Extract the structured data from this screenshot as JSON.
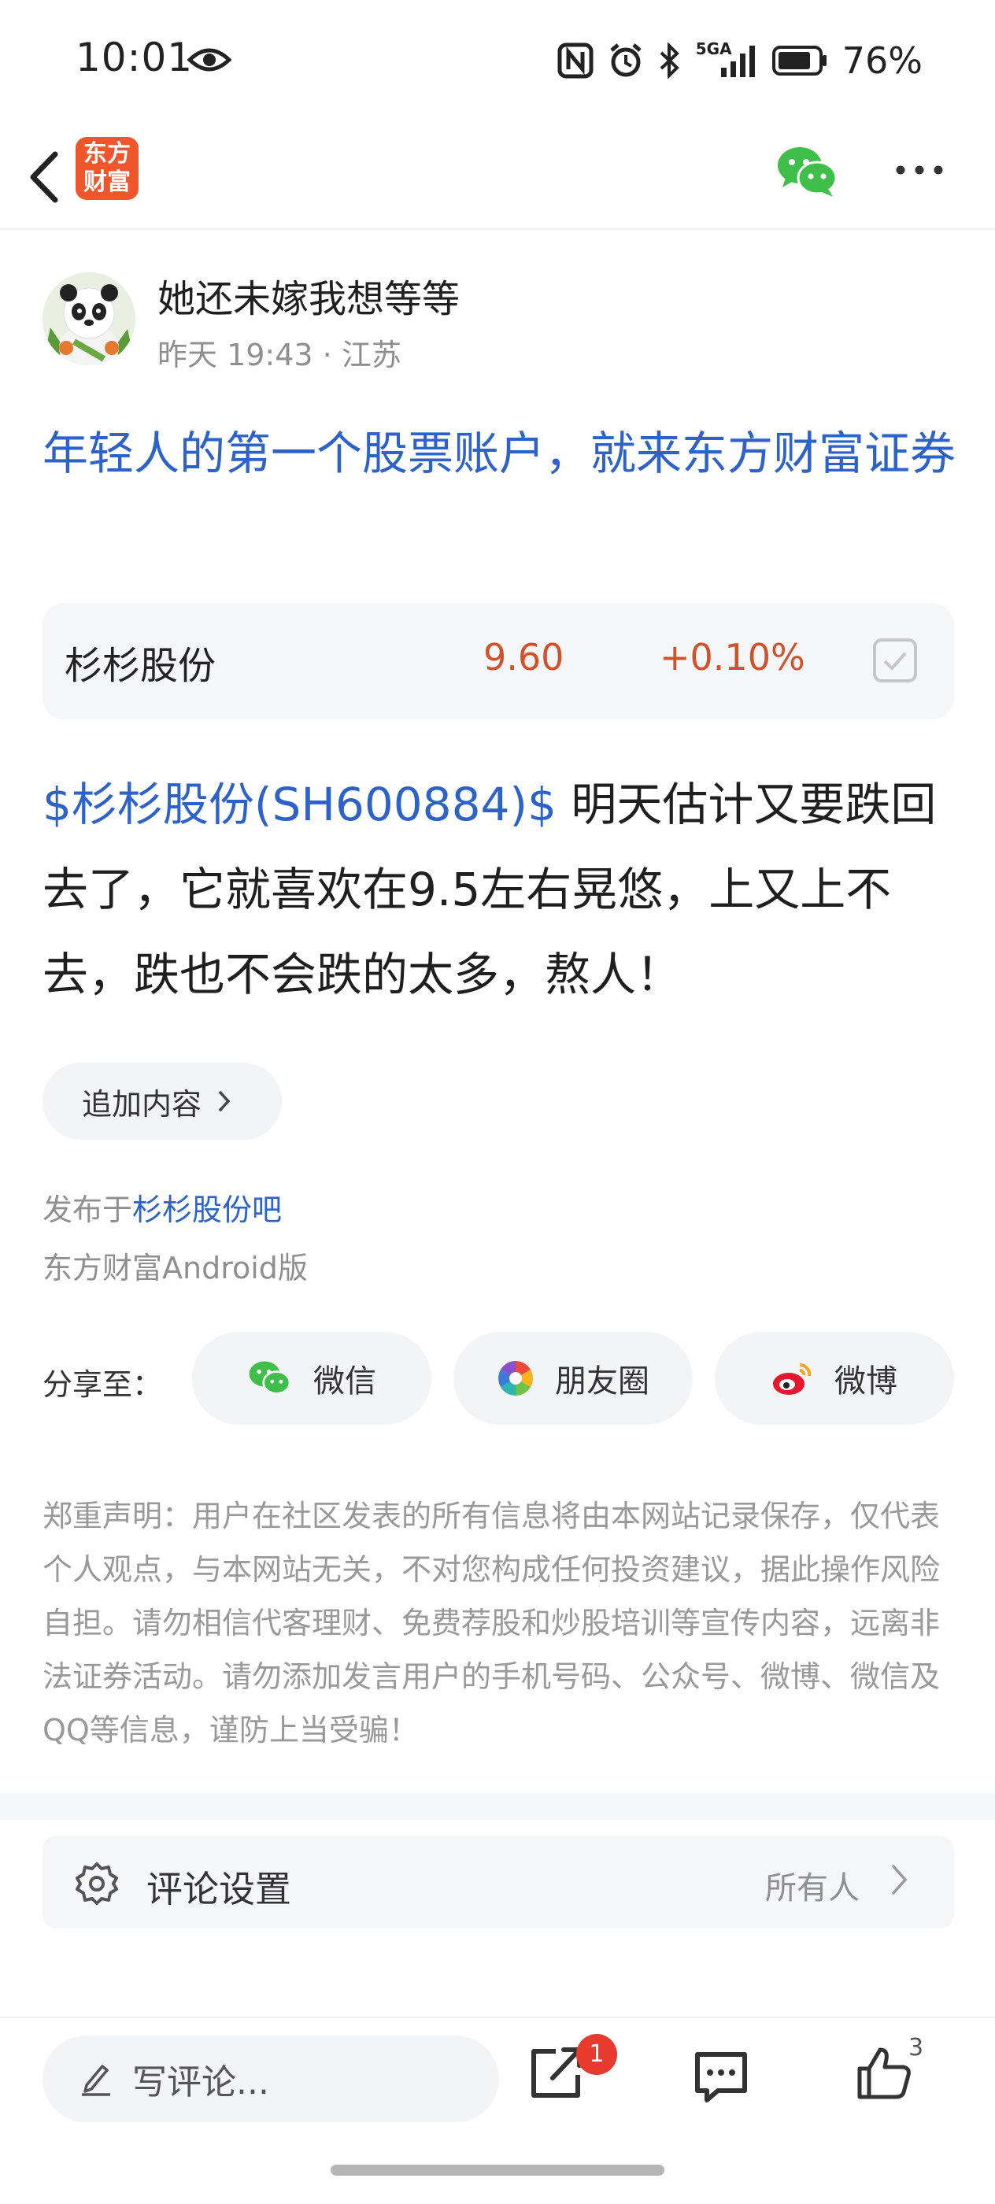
{
  "status_bar": {
    "time": "10:01",
    "network": "5GA",
    "battery": "76%"
  },
  "nav": {
    "logo_line1": "东方",
    "logo_line2": "财富"
  },
  "author": {
    "name": "她还未嫁我想等等",
    "meta": "昨天 19:43 · 江苏"
  },
  "post": {
    "title": "年轻人的第一个股票账户，就来东方财富证券",
    "stock": {
      "name": "杉杉股份",
      "price": "9.60",
      "change": "+0.10%"
    },
    "body_tag": "$杉杉股份(SH600884)$",
    "body_text": "明天估计又要跌回去了，它就喜欢在9.5左右晃悠，上又上不去，跌也不会跌的太多，熬人！",
    "add_content_label": "追加内容",
    "publish_prefix": "发布于",
    "forum_name": "杉杉股份吧",
    "client": "东方财富Android版"
  },
  "share": {
    "label": "分享至：",
    "wechat": "微信",
    "moments": "朋友圈",
    "weibo": "微博"
  },
  "disclaimer": "郑重声明：用户在社区发表的所有信息将由本网站记录保存，仅代表个人观点，与本网站无关，不对您构成任何投资建议，据此操作风险自担。请勿相信代客理财、免费荐股和炒股培训等宣传内容，远离非法证券活动。请勿添加发言用户的手机号码、公众号、微博、微信及QQ等信息，谨防上当受骗！",
  "comment_setting": {
    "label": "评论设置",
    "value": "所有人"
  },
  "bottom_bar": {
    "comment_placeholder": "写评论...",
    "share_badge": "1",
    "like_count": "3"
  },
  "colors": {
    "link_blue": "#2c62c9",
    "price_red": "#d2502a",
    "brand_orange": "#f0562c",
    "wechat_green": "#3fbf4a"
  }
}
